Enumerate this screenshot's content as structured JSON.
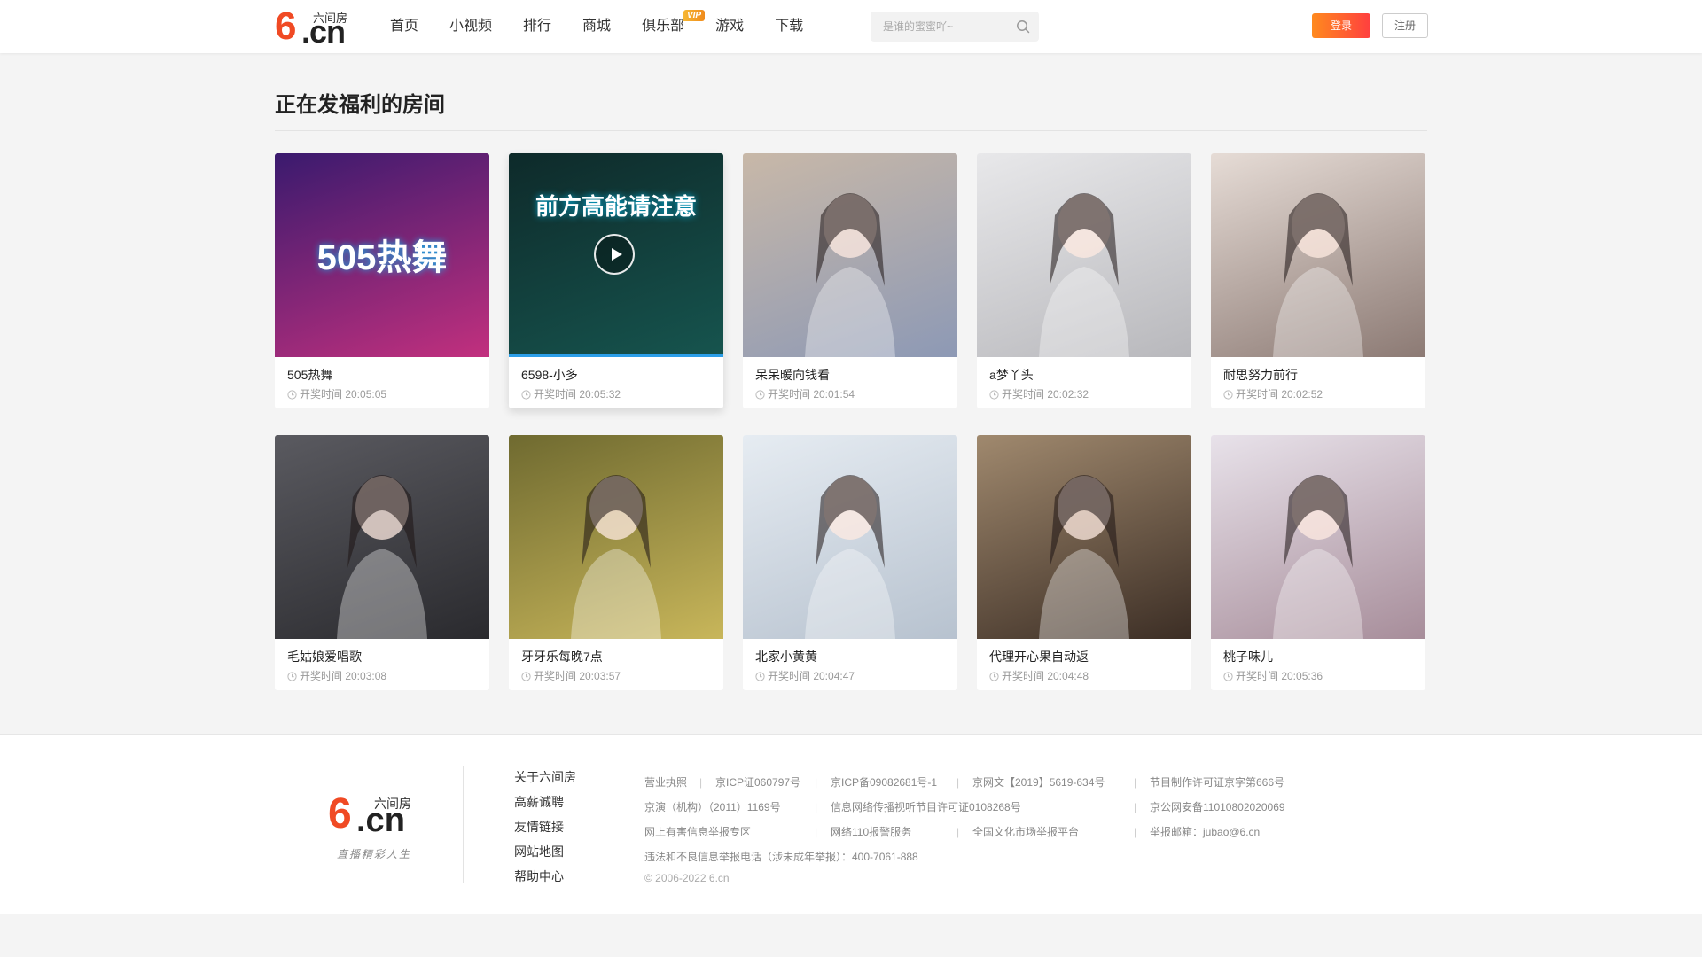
{
  "header": {
    "logo": {
      "six": "6",
      "dotcn": ".cn",
      "name": "六间房"
    },
    "nav": [
      {
        "label": "首页"
      },
      {
        "label": "小视频"
      },
      {
        "label": "排行"
      },
      {
        "label": "商城"
      },
      {
        "label": "俱乐部",
        "badge": "VIP"
      },
      {
        "label": "游戏"
      },
      {
        "label": "下载"
      }
    ],
    "search": {
      "placeholder": "是谁的蜜蜜吖~"
    },
    "login_label": "登录",
    "register_label": "注册"
  },
  "section": {
    "title": "正在发福利的房间"
  },
  "rooms": [
    {
      "name": "505热舞",
      "time_label": "开奖时间 20:05:05",
      "thumb_text": "505热舞",
      "colors": [
        "#3a1a6e",
        "#c2307e"
      ]
    },
    {
      "name": "6598-小多",
      "time_label": "开奖时间 20:05:32",
      "thumb_text": "前方高能请注意",
      "colors": [
        "#0e2a2a",
        "#16544e"
      ],
      "active": true
    },
    {
      "name": "呆呆暖向钱看",
      "time_label": "开奖时间 20:01:54",
      "thumb_text": "",
      "colors": [
        "#c8b8a8",
        "#8d99b5"
      ]
    },
    {
      "name": "a梦丫头",
      "time_label": "开奖时间 20:02:32",
      "thumb_text": "",
      "colors": [
        "#e8e8ea",
        "#b8b8bc"
      ]
    },
    {
      "name": "耐思努力前行",
      "time_label": "开奖时间 20:02:52",
      "thumb_text": "",
      "colors": [
        "#e6dcd6",
        "#8c7a74"
      ]
    },
    {
      "name": "毛姑娘爱唱歌",
      "time_label": "开奖时间 20:03:08",
      "thumb_text": "",
      "colors": [
        "#5a5a60",
        "#2a2a2e"
      ]
    },
    {
      "name": "牙牙乐每晚7点",
      "time_label": "开奖时间 20:03:57",
      "thumb_text": "",
      "colors": [
        "#6f6a30",
        "#c8b65a"
      ]
    },
    {
      "name": "北家小黄黄",
      "time_label": "开奖时间 20:04:47",
      "thumb_text": "",
      "colors": [
        "#e6ecf2",
        "#b7c2cf"
      ]
    },
    {
      "name": "代理开心果自动返",
      "time_label": "开奖时间 20:04:48",
      "thumb_text": "",
      "colors": [
        "#a0896e",
        "#3c2e25"
      ]
    },
    {
      "name": "桃子味儿",
      "time_label": "开奖时间 20:05:36",
      "thumb_text": "",
      "colors": [
        "#e8e2ea",
        "#a78d9a"
      ]
    }
  ],
  "footer": {
    "logo": {
      "six": "6",
      "dotcn": ".cn",
      "name": "六间房",
      "slogan": "直播精彩人生"
    },
    "links": [
      "关于六间房",
      "高薪诚聘",
      "友情链接",
      "网站地图",
      "帮助中心"
    ],
    "info_rows": [
      [
        "营业执照",
        "京ICP证060797号",
        "京ICP备09082681号-1",
        "京网文【2019】5619-634号",
        "节目制作许可证京字第666号"
      ],
      [
        "京演（机构）（2011）1169号",
        "信息网络传播视听节目许可证0108268号",
        "",
        "京公网安备11010802020069"
      ],
      [
        "网上有害信息举报专区",
        "网络110报警服务",
        "全国文化市场举报平台",
        "举报邮箱：jubao@6.cn"
      ]
    ],
    "report_phone": "违法和不良信息举报电话（涉未成年举报）：400-7061-888",
    "copyright": "© 2006-2022 6.cn"
  }
}
